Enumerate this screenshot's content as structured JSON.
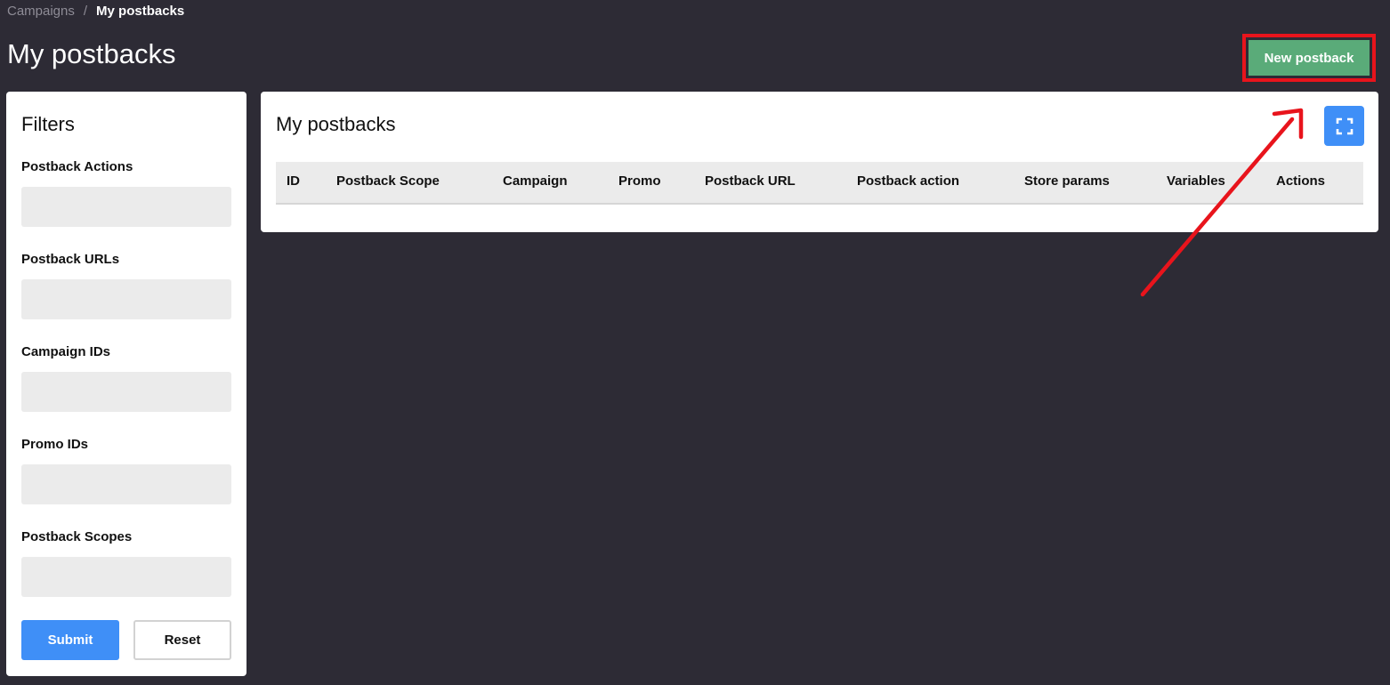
{
  "breadcrumb": {
    "parent": "Campaigns",
    "separator": "/",
    "current": "My postbacks"
  },
  "page_title": "My postbacks",
  "header": {
    "new_button_label": "New postback"
  },
  "filters": {
    "title": "Filters",
    "fields": [
      {
        "label": "Postback Actions",
        "value": ""
      },
      {
        "label": "Postback URLs",
        "value": ""
      },
      {
        "label": "Campaign IDs",
        "value": ""
      },
      {
        "label": "Promo IDs",
        "value": ""
      },
      {
        "label": "Postback Scopes",
        "value": ""
      }
    ],
    "submit_label": "Submit",
    "reset_label": "Reset"
  },
  "table": {
    "title": "My postbacks",
    "columns": [
      "ID",
      "Postback Scope",
      "Campaign",
      "Promo",
      "Postback URL",
      "Postback action",
      "Store params",
      "Variables",
      "Actions"
    ],
    "rows": []
  },
  "icons": {
    "expand": "fullscreen-icon"
  },
  "colors": {
    "background": "#2d2b35",
    "primary": "#3f8ff7",
    "success": "#5aab79",
    "highlight": "#e8141c"
  }
}
